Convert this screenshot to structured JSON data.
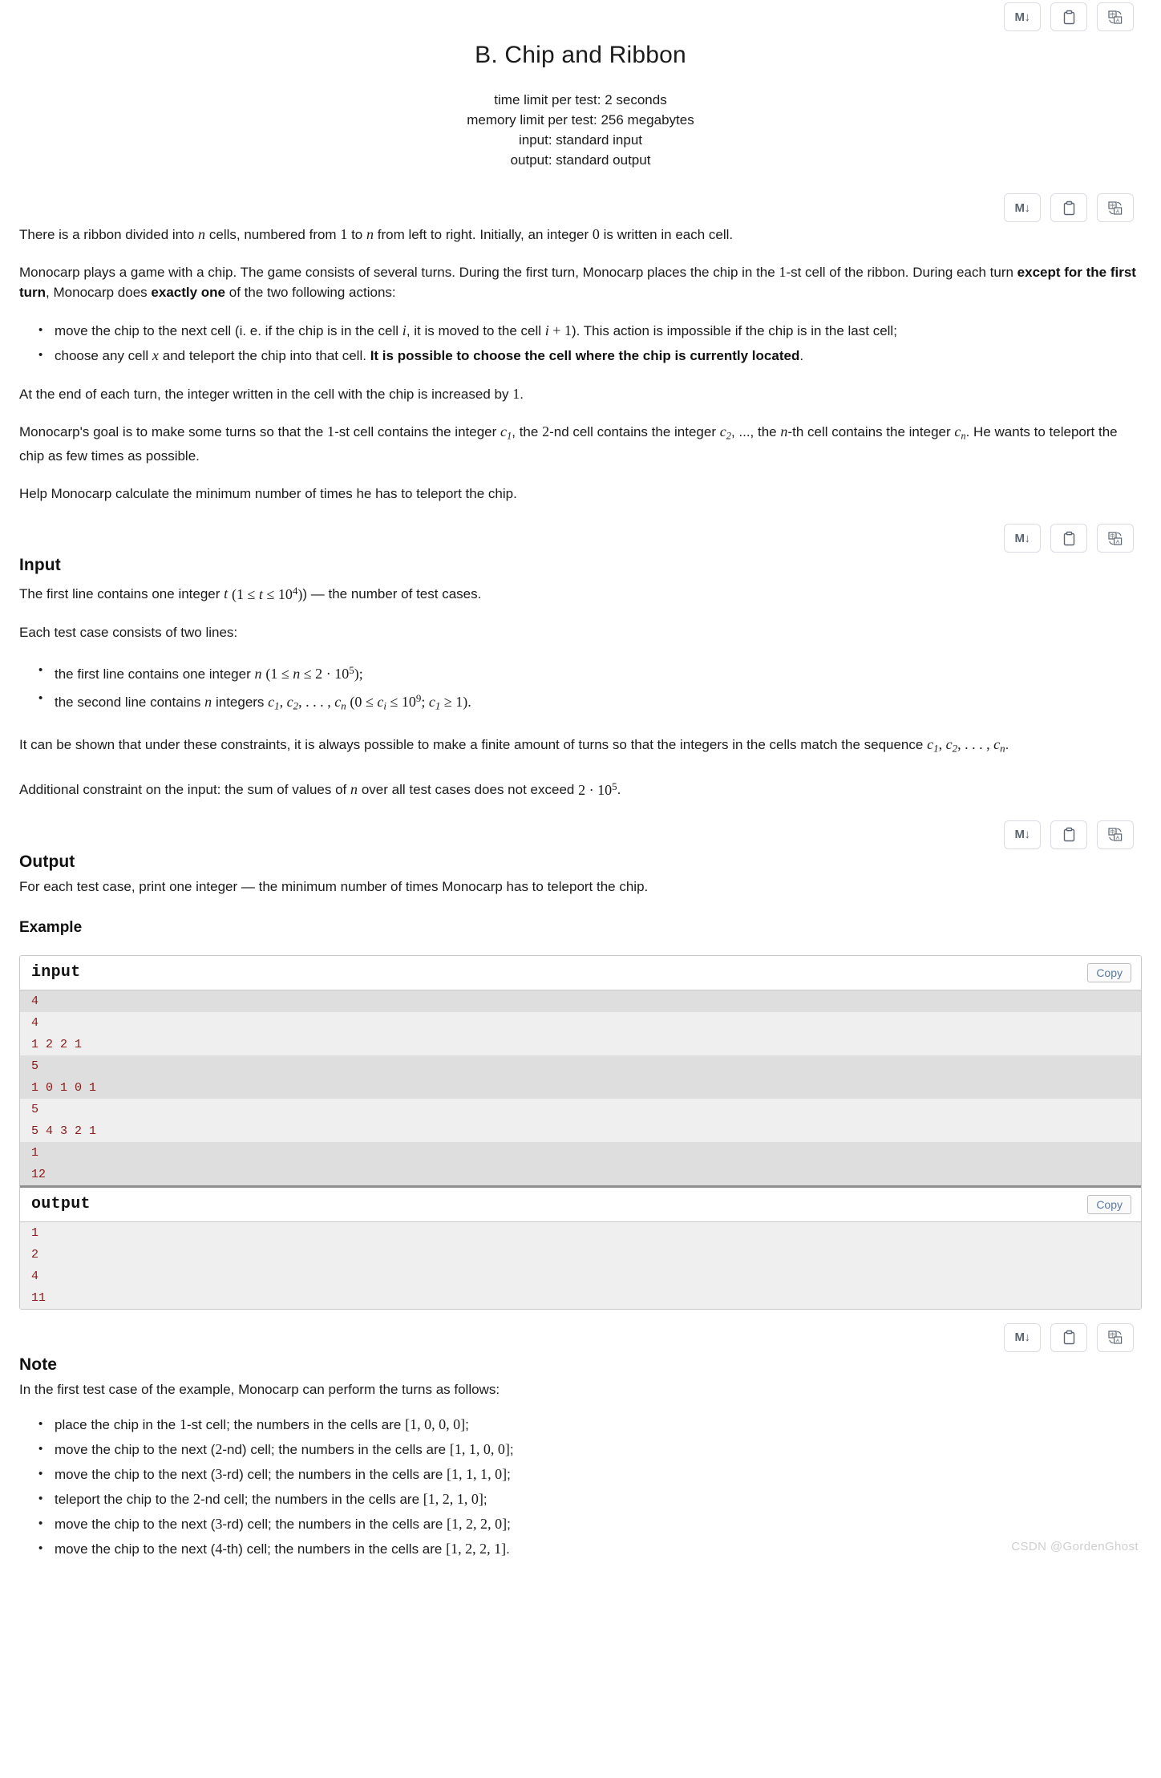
{
  "toolbar": {
    "markdown_label": "M",
    "icons": [
      {
        "name": "markdown-export-icon",
        "label": "M↓"
      },
      {
        "name": "clipboard-copy-icon",
        "label": "clipboard"
      },
      {
        "name": "translate-icon",
        "label": "中/A"
      }
    ]
  },
  "problem": {
    "title": "B. Chip and Ribbon",
    "time_limit": "time limit per test: 2 seconds",
    "memory_limit": "memory limit per test: 256 megabytes",
    "input_spec": "input: standard input",
    "output_spec": "output: standard output"
  },
  "statement": {
    "p1_a": "There is a ribbon divided into ",
    "p1_n": "n",
    "p1_b": " cells, numbered from ",
    "p1_one": "1",
    "p1_c": " to ",
    "p1_n2": "n",
    "p1_d": " from left to right. Initially, an integer ",
    "p1_zero": "0",
    "p1_e": " is written in each cell.",
    "p2_a": "Monocarp plays a game with a chip. The game consists of several turns. During the first turn, Monocarp places the chip in the ",
    "p2_one": "1",
    "p2_b": "-st cell of the ribbon. During each turn ",
    "p2_bold1": "except for the first turn",
    "p2_c": ", Monocarp does ",
    "p2_bold2": "exactly one",
    "p2_d": " of the two following actions:",
    "li1_a": "move the chip to the next cell (i. e. if the chip is in the cell ",
    "li1_i": "i",
    "li1_b": ", it is moved to the cell ",
    "li1_ip1": "i + 1",
    "li1_c": "). This action is impossible if the chip is in the last cell;",
    "li2_a": "choose any cell ",
    "li2_x": "x",
    "li2_b": " and teleport the chip into that cell. ",
    "li2_bold": "It is possible to choose the cell where the chip is currently located",
    "li2_c": ".",
    "p3_a": "At the end of each turn, the integer written in the cell with the chip is increased by ",
    "p3_one": "1",
    "p3_b": ".",
    "p4_a": "Monocarp's goal is to make some turns so that the ",
    "p4_one": "1",
    "p4_b": "-st cell contains the integer ",
    "p4_c1": "c",
    "p4_c1sub": "1",
    "p4_c": ", the ",
    "p4_two": "2",
    "p4_d": "-nd cell contains the integer ",
    "p4_c2": "c",
    "p4_c2sub": "2",
    "p4_e": ", ..., the ",
    "p4_n": "n",
    "p4_f": "-th cell contains the integer ",
    "p4_cn": "c",
    "p4_cnsub": "n",
    "p4_g": ". He wants to teleport the chip as few times as possible.",
    "p5": "Help Monocarp calculate the minimum number of times he has to teleport the chip."
  },
  "input_section": {
    "heading": "Input",
    "line1_a": "The first line contains one integer ",
    "line1_t": "t",
    "line1_constraint": "(1 ≤ t ≤ 10",
    "line1_exp": "4",
    "line1_b": ") — the number of test cases.",
    "line2": "Each test case consists of two lines:",
    "b1_a": "the first line contains one integer ",
    "b1_n": "n",
    "b1_constraint": "(1 ≤ n ≤ 2 · 10",
    "b1_exp": "5",
    "b1_end": ");",
    "b2_a": "the second line contains ",
    "b2_n": "n",
    "b2_b": " integers ",
    "b2_seq": "c₁, c₂, . . . , cₙ",
    "b2_constraint_a": "(0 ≤ c",
    "b2_sub_i": "i",
    "b2_constraint_b": " ≤ 10",
    "b2_exp9": "9",
    "b2_constraint_c": "; c",
    "b2_sub_1": "1",
    "b2_constraint_d": " ≥ 1).",
    "note_a": "It can be shown that under these constraints, it is always possible to make a finite amount of turns so that the integers in the cells match the sequence ",
    "note_seq": "c₁, c₂, . . . , cₙ",
    "note_b": ".",
    "extra_a": "Additional constraint on the input: the sum of values of ",
    "extra_n": "n",
    "extra_b": " over all test cases does not exceed ",
    "extra_val": "2 · 10",
    "extra_exp": "5",
    "extra_c": "."
  },
  "output_section": {
    "heading": "Output",
    "text": "For each test case, print one integer — the minimum number of times Monocarp has to teleport the chip."
  },
  "example": {
    "heading": "Example",
    "input_label": "input",
    "output_label": "output",
    "copy_label": "Copy",
    "input_lines": [
      "4",
      "4",
      "1 2 2 1",
      "5",
      "1 0 1 0 1",
      "5",
      "5 4 3 2 1",
      "1",
      "12"
    ],
    "output_lines": [
      "1",
      "2",
      "4",
      "11"
    ]
  },
  "note_section": {
    "heading": "Note",
    "intro": "In the first test case of the example, Monocarp can perform the turns as follows:",
    "bullets": [
      {
        "pre": "place the chip in the ",
        "num": "1",
        "mid": "-st cell; the numbers in the cells are ",
        "arr": "[1, 0, 0, 0]",
        "end": ";"
      },
      {
        "pre": "move the chip to the next (",
        "num": "2",
        "mid": "-nd) cell; the numbers in the cells are ",
        "arr": "[1, 1, 0, 0]",
        "end": ";"
      },
      {
        "pre": "move the chip to the next (",
        "num": "3",
        "mid": "-rd) cell; the numbers in the cells are ",
        "arr": "[1, 1, 1, 0]",
        "end": ";"
      },
      {
        "pre": "teleport the chip to the ",
        "num": "2",
        "mid": "-nd cell; the numbers in the cells are ",
        "arr": "[1, 2, 1, 0]",
        "end": ";"
      },
      {
        "pre": "move the chip to the next (",
        "num": "3",
        "mid": "-rd) cell; the numbers in the cells are ",
        "arr": "[1, 2, 2, 0]",
        "end": ";"
      },
      {
        "pre": "move the chip to the next (",
        "num": "4",
        "mid": "-th) cell; the numbers in the cells are ",
        "arr": "[1, 2, 2, 1]",
        "end": "."
      }
    ]
  },
  "watermark": "CSDN @GordenGhost",
  "colors": {
    "code_text": "#8b1a1a",
    "code_bg": "#efefef",
    "code_bg_alt": "#dedede",
    "copy_text": "#5b7ba0",
    "icon_stroke": "#5a6472"
  }
}
